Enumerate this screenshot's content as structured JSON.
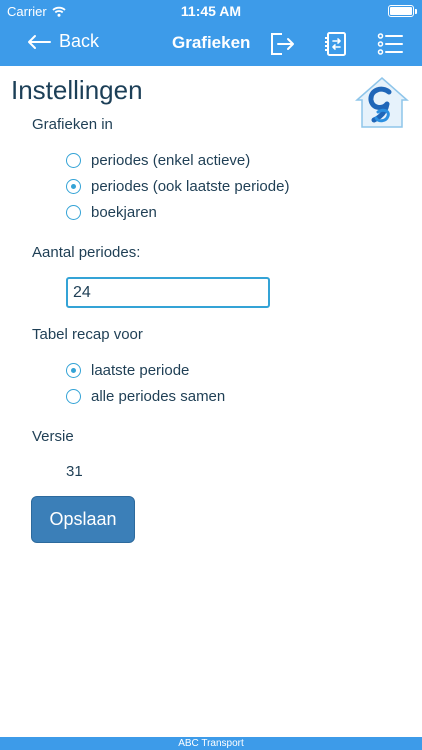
{
  "status_bar": {
    "carrier": "Carrier",
    "time": "11:45 AM",
    "battery_level": 1.0
  },
  "navbar": {
    "back_label": "Back",
    "title": "Grafieken",
    "icons": [
      "logout-icon",
      "contacts-book-icon",
      "list-menu-icon"
    ]
  },
  "page": {
    "title": "Instellingen"
  },
  "settings": {
    "charts_label": "Grafieken in",
    "chart_options": [
      {
        "label": "periodes (enkel actieve)",
        "checked": false
      },
      {
        "label": "periodes (ook laatste periode)",
        "checked": true
      },
      {
        "label": "boekjaren",
        "checked": false
      }
    ],
    "period_count_label": "Aantal periodes:",
    "period_count_value": "24",
    "recap_label": "Tabel recap voor",
    "recap_options": [
      {
        "label": "laatste periode",
        "checked": true
      },
      {
        "label": "alle periodes samen",
        "checked": false
      }
    ],
    "version_label": "Versie",
    "version_value": "31",
    "save_label": "Opslaan"
  },
  "footer": {
    "text": "ABC Transport"
  },
  "colors": {
    "brand_blue": "#3d9be9",
    "button_blue": "#3b7fb8",
    "radio_accent": "#34a3d6",
    "text_dark": "#1f3f55"
  }
}
